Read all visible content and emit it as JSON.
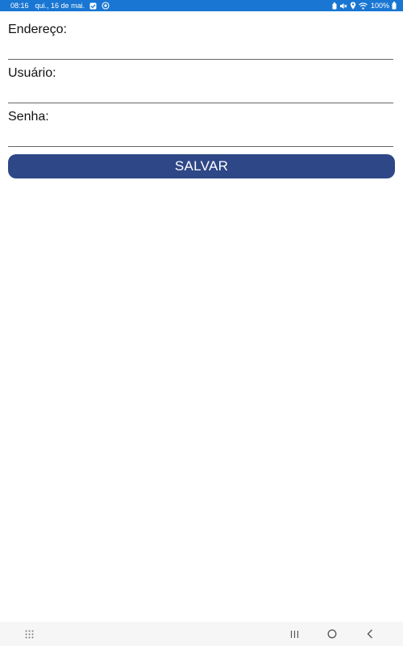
{
  "status_bar": {
    "time": "08:16",
    "date": "qui., 16 de mai.",
    "battery": "100%",
    "background_color": "#1976d2",
    "left_icons": [
      "checkbox-icon",
      "sync-icon"
    ],
    "right_icons": [
      "battery-saver-icon",
      "mute-icon",
      "location-icon",
      "wifi-icon",
      "battery-icon"
    ]
  },
  "form": {
    "fields": [
      {
        "label": "Endereço:",
        "value": ""
      },
      {
        "label": "Usuário:",
        "value": ""
      },
      {
        "label": "Senha:",
        "value": ""
      }
    ],
    "save_label": "SALVAR",
    "save_color": "#2e4787"
  },
  "nav_bar": {
    "buttons": [
      "apps-grid-icon",
      "recent-apps-icon",
      "home-icon",
      "back-icon"
    ]
  }
}
